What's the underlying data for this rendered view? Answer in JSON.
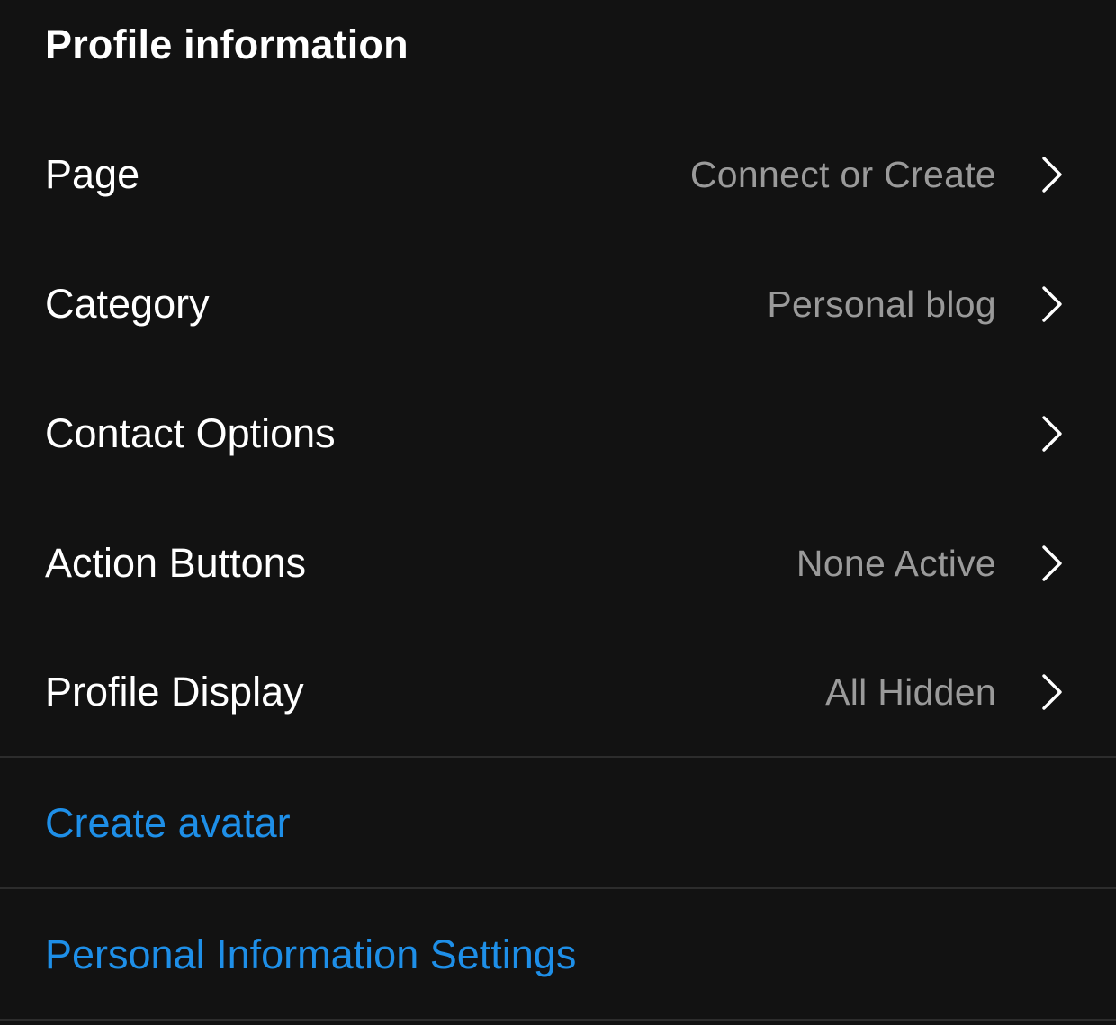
{
  "section": {
    "title": "Profile information"
  },
  "rows": [
    {
      "label": "Page",
      "value": "Connect or Create"
    },
    {
      "label": "Category",
      "value": "Personal blog"
    },
    {
      "label": "Contact Options",
      "value": ""
    },
    {
      "label": "Action Buttons",
      "value": "None Active"
    },
    {
      "label": "Profile Display",
      "value": "All Hidden"
    }
  ],
  "links": {
    "create_avatar": "Create avatar",
    "personal_info": "Personal Information Settings"
  },
  "icons": {
    "chevron": "chevron-right-icon"
  },
  "colors": {
    "background": "#121212",
    "text_primary": "#ffffff",
    "text_secondary": "#9a9a9a",
    "link": "#1e8fe8",
    "divider": "#2c2c2c"
  }
}
